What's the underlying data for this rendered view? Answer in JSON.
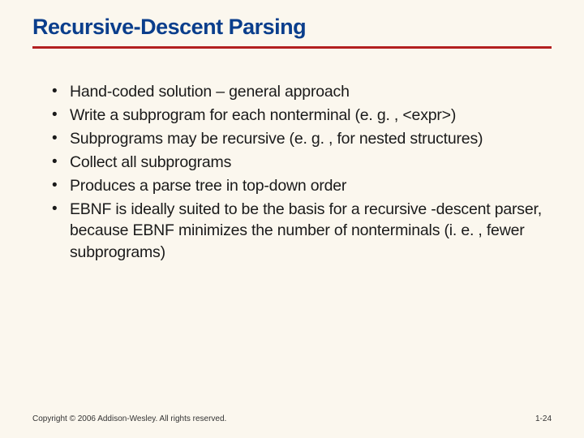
{
  "title": "Recursive-Descent Parsing",
  "bullets": [
    "Hand-coded solution – general approach",
    "Write a subprogram for each nonterminal (e. g. , <expr>)",
    "Subprograms may be recursive (e. g. , for nested structures)",
    "Collect all subprograms",
    "Produces a parse tree in top-down order",
    "EBNF is ideally suited to be the basis for a recursive -descent parser, because EBNF minimizes the number of nonterminals (i. e. , fewer subprograms)"
  ],
  "footer": {
    "copyright": "Copyright © 2006 Addison-Wesley. All rights reserved.",
    "page": "1-24"
  }
}
